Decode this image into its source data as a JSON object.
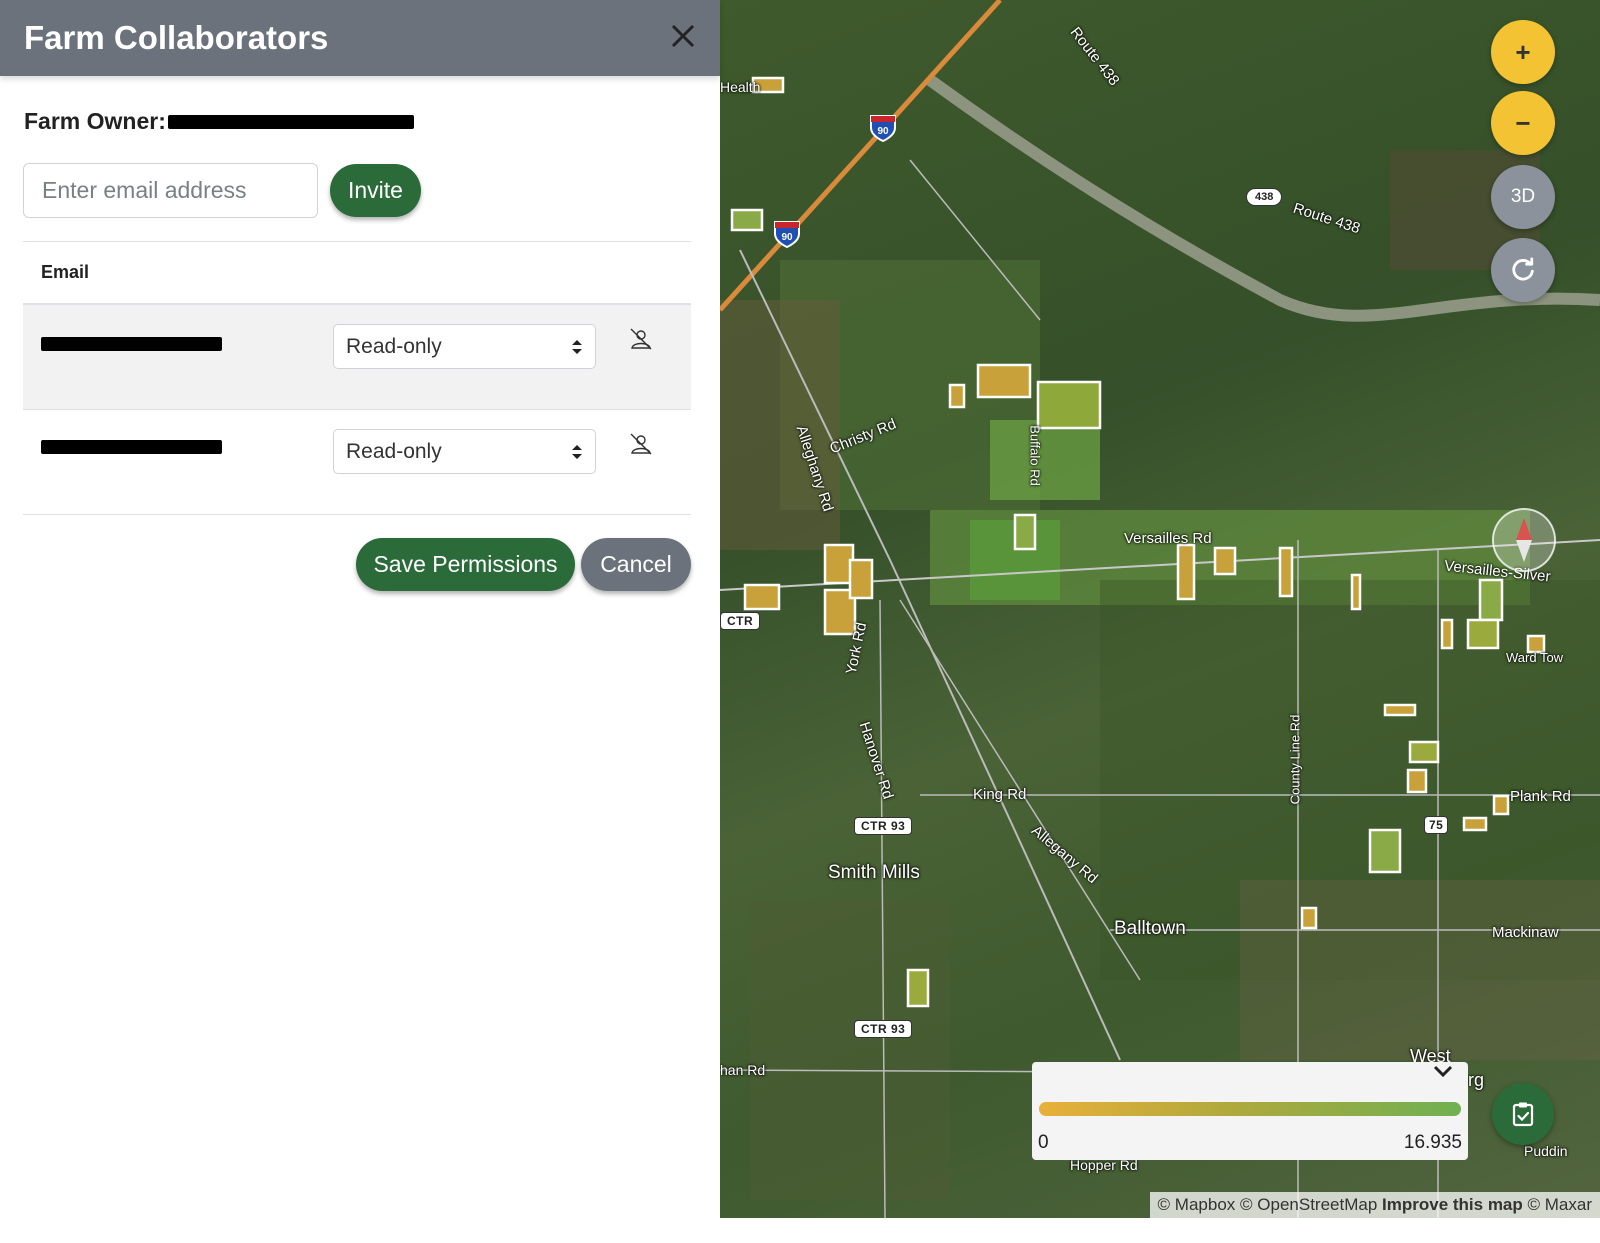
{
  "panel": {
    "title": "Farm Collaborators",
    "close_icon": "close-icon",
    "owner_label": "Farm Owner:",
    "invite_placeholder": "Enter email address",
    "invite_label": "Invite",
    "table_header_email": "Email",
    "collaborators": [
      {
        "email": "[redacted]",
        "permission": "Read-only"
      },
      {
        "email": "[redacted]",
        "permission": "Read-only"
      }
    ],
    "save_label": "Save Permissions",
    "cancel_label": "Cancel",
    "accent_color": "#2b6b3a",
    "header_color": "#6b727c"
  },
  "map": {
    "controls": {
      "zoom_in": "+",
      "zoom_out": "−",
      "view_3d": "3D",
      "reset_icon": "rotate-icon",
      "compass_icon": "compass-icon",
      "clipboard_icon": "clipboard-check-icon"
    },
    "labels": {
      "route438_a": "Route 438",
      "route438_b": "Route 438",
      "christy": "Christy Rd",
      "buffalo": "Buffalo Rd",
      "versailles": "Versailles Rd",
      "versailles_silver": "Versailles-Silver",
      "allegheny": "Alleghany Rd",
      "york": "York Rd",
      "hanover": "Hanover Rd",
      "king": "King Rd",
      "allegany": "Allegany Rd",
      "county_line": "County Line Rd",
      "plank": "Plank Rd",
      "smith_mills": "Smith Mills",
      "balltown": "Balltown",
      "mackinaw": "Mackinaw",
      "west": "West",
      "west_suffix": "rg",
      "hopper": "Hopper Rd",
      "ward_town": "Ward Tow",
      "puddin": "Puddin",
      "han": "han Rd",
      "health": "Health",
      "ctr93_a": "CTR 93",
      "ctr93_b": "CTR 93",
      "ctr_left": "CTR",
      "shield_438": "438",
      "shield_75": "75",
      "i90_a": "90",
      "i90_b": "90"
    },
    "legend": {
      "min": "0",
      "max": "16.935",
      "gradient_start": "#e8b03a",
      "gradient_end": "#6fb052"
    },
    "attribution": {
      "mapbox": "© Mapbox",
      "osm": "© OpenStreetMap",
      "improve": "Improve this map",
      "maxar": "© Maxar"
    }
  }
}
